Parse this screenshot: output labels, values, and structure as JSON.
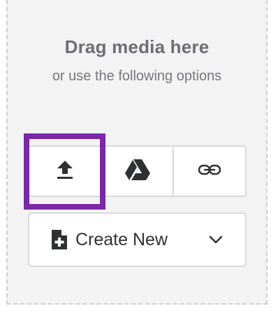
{
  "dropzone": {
    "title": "Drag media here",
    "subtitle": "or use the following options"
  },
  "upload_options": [
    {
      "icon": "upload-icon"
    },
    {
      "icon": "google-drive-icon"
    },
    {
      "icon": "link-icon"
    }
  ],
  "create_new": {
    "label": "Create New",
    "icon": "new-file-icon",
    "dropdown_icon": "chevron-down-icon"
  },
  "colors": {
    "highlight": "#7b27a8",
    "text_dark": "#2f3133",
    "text_muted": "#6b6e73",
    "border": "#dadada",
    "dropzone_bg": "#f3f3f3"
  }
}
